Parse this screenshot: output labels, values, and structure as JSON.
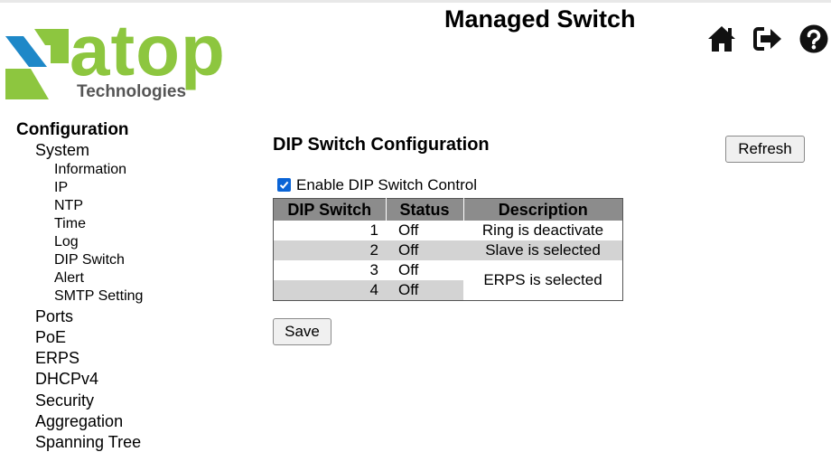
{
  "header": {
    "title": "Managed Switch",
    "logo": {
      "word": "atop",
      "sub": "Technologies",
      "colors": {
        "green": "#8dc63f",
        "blue": "#1e88c8",
        "grey": "#555555"
      }
    },
    "icons": [
      "home-icon",
      "logout-icon",
      "help-icon"
    ]
  },
  "sidebar": {
    "section": "Configuration",
    "system": {
      "label": "System",
      "children": [
        "Information",
        "IP",
        "NTP",
        "Time",
        "Log",
        "DIP Switch",
        "Alert",
        "SMTP Setting"
      ]
    },
    "items": [
      "Ports",
      "PoE",
      "ERPS",
      "DHCPv4",
      "Security",
      "Aggregation",
      "Spanning Tree"
    ]
  },
  "main": {
    "title": "DIP Switch Configuration",
    "refresh_label": "Refresh",
    "enable_label": "Enable DIP Switch Control",
    "enable_checked": true,
    "table": {
      "headers": [
        "DIP Switch",
        "Status",
        "Description"
      ],
      "rows": [
        {
          "switch": "1",
          "status": "Off"
        },
        {
          "switch": "2",
          "status": "Off"
        },
        {
          "switch": "3",
          "status": "Off"
        },
        {
          "switch": "4",
          "status": "Off"
        }
      ],
      "descriptions": [
        "Ring is deactivate",
        "Slave is selected",
        "ERPS is selected"
      ]
    },
    "save_label": "Save"
  },
  "colors": {
    "header_bg": "#8c8c8c",
    "row_alt": "#d3d3d3",
    "checkbox": "#0a64d6"
  }
}
